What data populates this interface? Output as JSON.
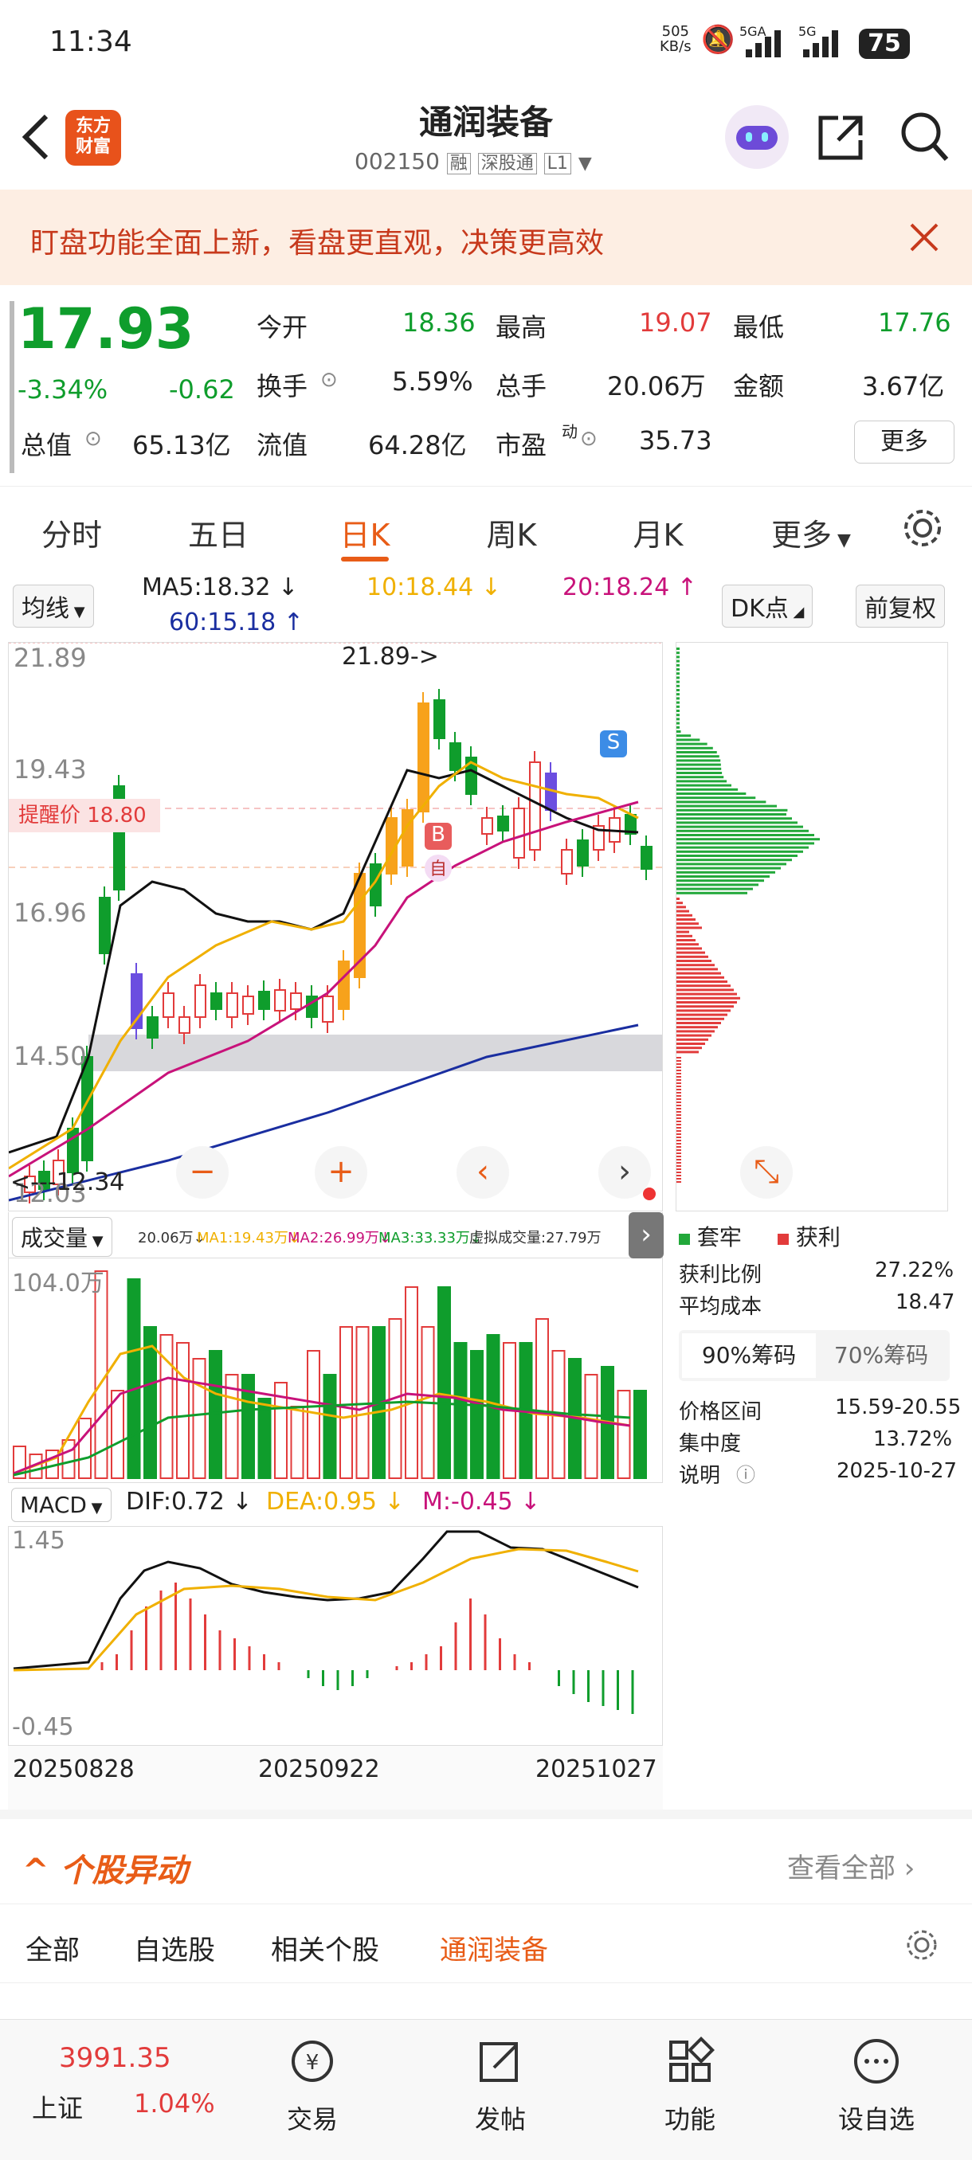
{
  "status": {
    "time": "11:34",
    "speed_top": "505",
    "speed_bottom": "KB/s",
    "net1": "5GA",
    "net2": "5G",
    "battery": "75"
  },
  "header": {
    "title": "通润装备",
    "code": "002150",
    "tags": [
      "融",
      "深股通",
      "L1"
    ],
    "logo_line1": "东方",
    "logo_line2": "财富"
  },
  "banner": {
    "text": "盯盘功能全面上新，看盘更直观，决策更高效"
  },
  "quote": {
    "price": "17.93",
    "pct": "-3.34%",
    "chg": "-0.62",
    "open_label": "今开",
    "open": "18.36",
    "high_label": "最高",
    "high": "19.07",
    "low_label": "最低",
    "low": "17.76",
    "turnover_label": "换手",
    "turnover": "5.59%",
    "vol_label": "总手",
    "vol": "20.06万",
    "amount_label": "金额",
    "amount": "3.67亿",
    "mcap_label": "总值",
    "mcap": "65.13亿",
    "float_label": "流值",
    "float": "64.28亿",
    "pe_label": "市盈",
    "pe_sup": "动",
    "pe": "35.73",
    "more": "更多"
  },
  "tabs": [
    "分时",
    "五日",
    "日K",
    "周K",
    "月K",
    "更多"
  ],
  "ma": {
    "selector": "均线",
    "ma5": "MA5:18.32 ↓",
    "ma10": "10:18.44 ↓",
    "ma20": "20:18.24 ↑",
    "ma60": "60:15.18 ↑",
    "dk": "DK点",
    "adjust": "前复权"
  },
  "kline": {
    "y_labels": [
      "21.89",
      "19.43",
      "16.96",
      "14.50",
      "12.03"
    ],
    "high_mark": "21.89->",
    "low_mark": "<---12.34",
    "alert": "提醒价 18.80",
    "buy": "B",
    "sell": "S",
    "self": "自"
  },
  "volume": {
    "selector": "成交量",
    "values_text": [
      "20.06万↓",
      "MA1:19.43万↓",
      "MA2:26.99万↓",
      "MA3:33.33万↓",
      "虚拟成交量:27.79万"
    ],
    "ymax": "104.0万"
  },
  "macd": {
    "selector": "MACD",
    "dif": "DIF:0.72 ↓",
    "dea": "DEA:0.95 ↓",
    "m": "M:-0.45 ↓",
    "ymax": "1.45",
    "ymin": "-0.45",
    "dates": [
      "20250828",
      "20250922",
      "20251027"
    ]
  },
  "chips": {
    "legend_trap": "套牢",
    "legend_profit": "获利",
    "profit_ratio_label": "获利比例",
    "profit_ratio": "27.22%",
    "avg_cost_label": "平均成本",
    "avg_cost": "18.47",
    "tab90": "90%筹码",
    "tab70": "70%筹码",
    "range_label": "价格区间",
    "range": "15.59-20.55",
    "conc_label": "集中度",
    "conc": "13.72%",
    "note_label": "说明",
    "note_date": "2025-10-27"
  },
  "movers": {
    "title": "个股异动",
    "view_all": "查看全部",
    "filters": [
      "全部",
      "自选股",
      "相关个股",
      "通润装备"
    ]
  },
  "bottom": {
    "index_val": "3991.35",
    "index_name": "上证",
    "index_pct": "1.04%",
    "trade": "交易",
    "post": "发帖",
    "func": "功能",
    "watch": "设自选"
  },
  "colors": {
    "up": "#e23b3b",
    "down": "#0f9d2c",
    "accent": "#e85c17",
    "ma5": "#111111",
    "ma10": "#f0b000",
    "ma20": "#c8127a",
    "ma60": "#1a2ea0"
  }
}
